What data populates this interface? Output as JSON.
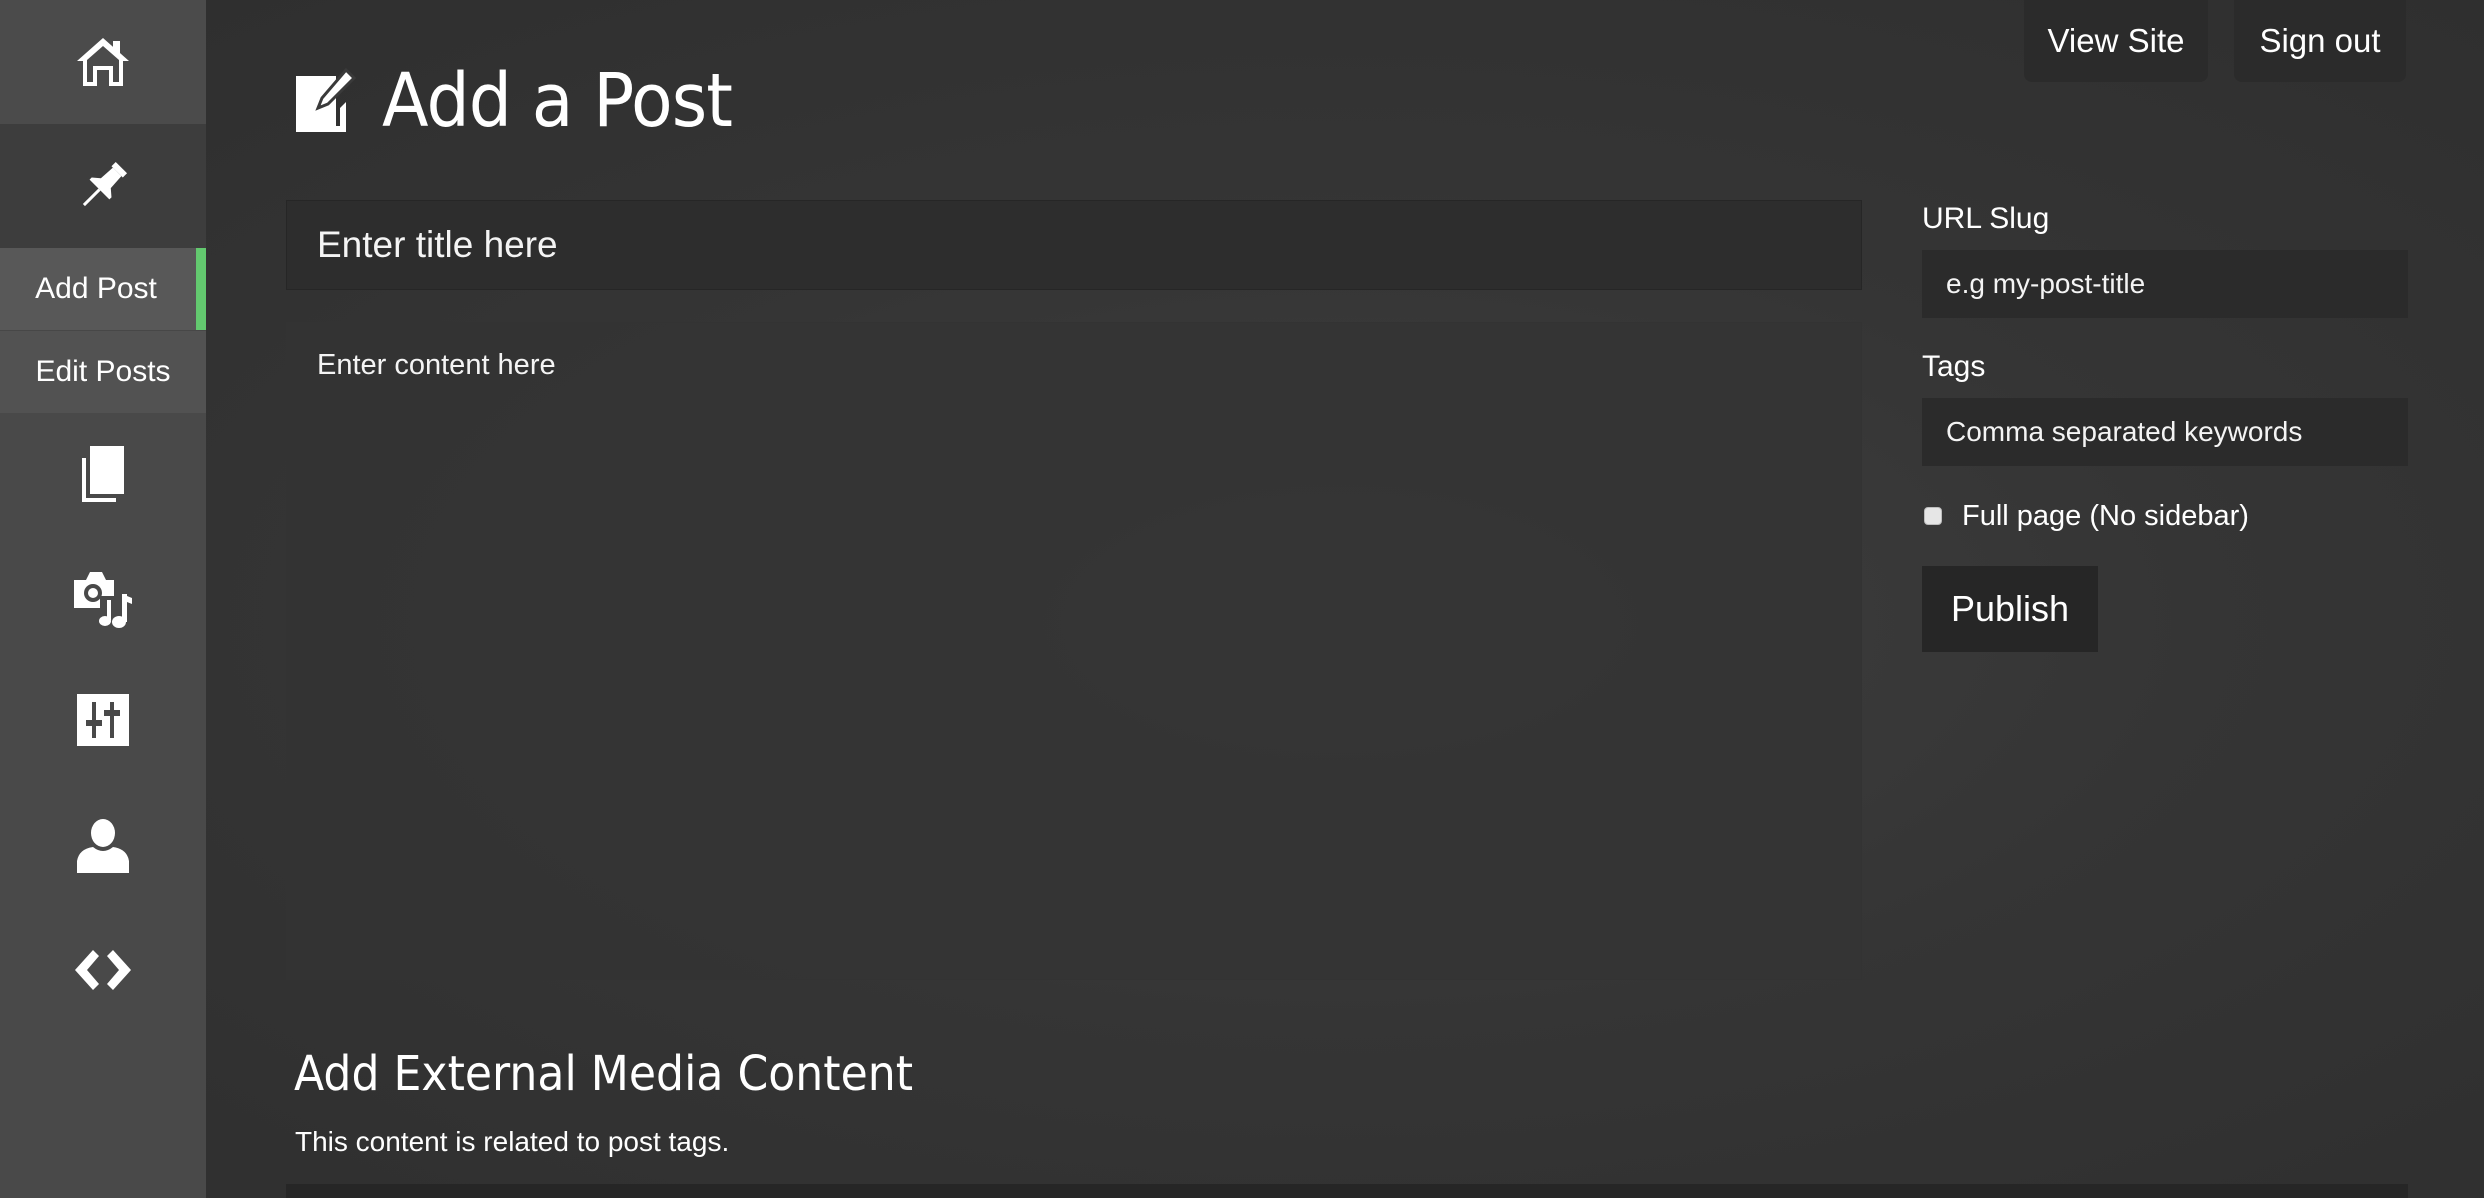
{
  "sidebar": {
    "items": [
      {
        "icon": "home-icon"
      },
      {
        "icon": "pin-icon"
      },
      {
        "label": "Add Post",
        "active": true
      },
      {
        "label": "Edit Posts"
      },
      {
        "icon": "pages-icon"
      },
      {
        "icon": "media-icon"
      },
      {
        "icon": "settings-icon"
      },
      {
        "icon": "user-icon"
      },
      {
        "icon": "code-icon"
      }
    ],
    "active_color": "#63c96f"
  },
  "header": {
    "title": "Add a Post",
    "title_icon": "edit-icon",
    "view_site": "View Site",
    "sign_out": "Sign out"
  },
  "editor": {
    "title_placeholder": "Enter title here",
    "content_placeholder": "Enter content here"
  },
  "settings": {
    "slug_label": "URL Slug",
    "slug_placeholder": "e.g my-post-title",
    "tags_label": "Tags",
    "tags_placeholder": "Comma separated keywords",
    "full_page_label": "Full page (No sidebar)",
    "full_page_checked": false,
    "publish": "Publish"
  },
  "media": {
    "title": "Add External Media Content",
    "subtitle": "This content is related to post tags."
  }
}
